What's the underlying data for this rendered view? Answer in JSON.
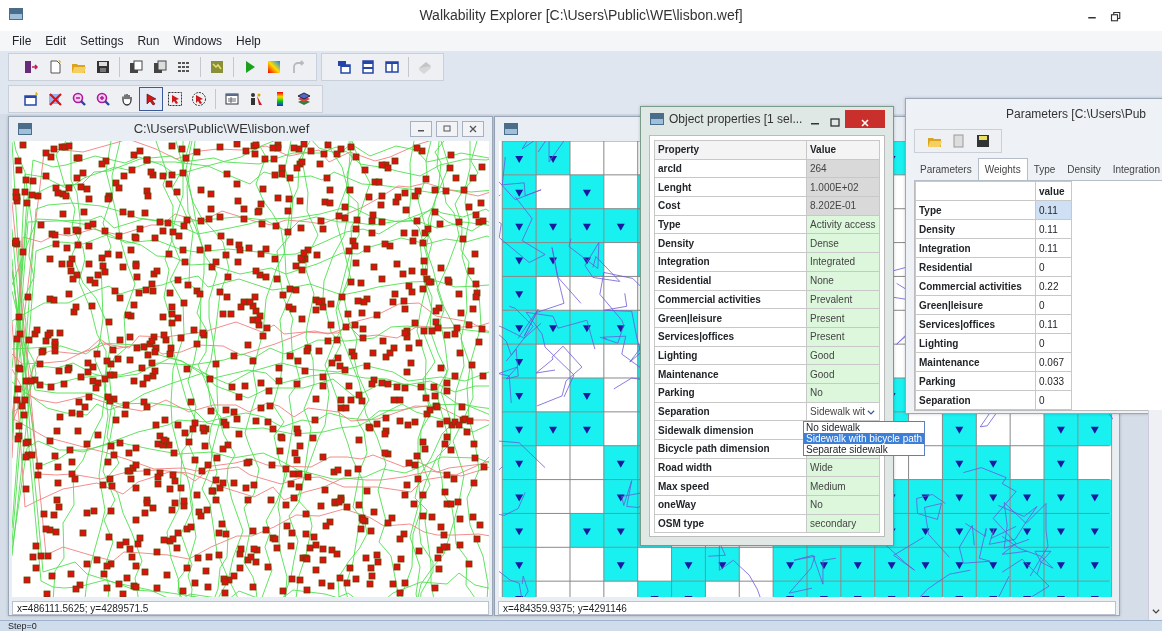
{
  "window": {
    "title": "Walkability Explorer [C:\\Users\\Public\\WE\\lisbon.wef]"
  },
  "menu": [
    "File",
    "Edit",
    "Settings",
    "Run",
    "Windows",
    "Help"
  ],
  "toolbar_1": [
    {
      "disabled": false
    },
    {
      "disabled": false
    },
    {
      "disabled": false
    },
    {
      "disabled": false
    },
    {
      "disabled": false
    },
    {
      "disabled": false
    },
    {
      "disabled": false
    },
    {
      "disabled": false
    },
    {
      "disabled": false
    },
    {
      "disabled": false
    },
    {
      "disabled": true
    },
    {
      "disabled": false
    },
    {
      "disabled": false
    },
    {
      "disabled": false
    },
    {
      "disabled": true
    }
  ],
  "toolbar_2": [
    {
      "selected": false
    },
    {
      "selected": false
    },
    {
      "selected": false
    },
    {
      "selected": false
    },
    {
      "selected": false
    },
    {
      "selected": true
    },
    {
      "selected": false
    },
    {
      "selected": false
    },
    {
      "selected": false
    },
    {
      "selected": false
    },
    {
      "selected": false
    },
    {
      "selected": false
    }
  ],
  "map_windows": [
    {
      "title": "C:\\Users\\Public\\WE\\lisbon.wef",
      "coordinates": "x=486111.5625; y=4289571.5"
    },
    {
      "coordinates": "x=484359.9375; y=4291146"
    }
  ],
  "object_properties": {
    "title": "Object properties [1 sel...",
    "columns": [
      "Property",
      "Value"
    ],
    "rows": [
      {
        "property": "arcId",
        "value": "264",
        "kind": "readonly"
      },
      {
        "property": "Lenght",
        "value": "1.000E+02",
        "kind": "readonly"
      },
      {
        "property": "Cost",
        "value": "8.202E-01",
        "kind": "readonly"
      },
      {
        "property": "Type",
        "value": "Activity access",
        "kind": "edit"
      },
      {
        "property": "Density",
        "value": "Dense",
        "kind": "edit"
      },
      {
        "property": "Integration",
        "value": "Integrated",
        "kind": "edit"
      },
      {
        "property": "Residential",
        "value": "None",
        "kind": "edit"
      },
      {
        "property": "Commercial activities",
        "value": "Prevalent",
        "kind": "edit"
      },
      {
        "property": "Green|leisure",
        "value": "Present",
        "kind": "edit"
      },
      {
        "property": "Services|offices",
        "value": "Present",
        "kind": "edit"
      },
      {
        "property": "Lighting",
        "value": "Good",
        "kind": "edit"
      },
      {
        "property": "Maintenance",
        "value": "Good",
        "kind": "edit"
      },
      {
        "property": "Parking",
        "value": "No",
        "kind": "edit"
      },
      {
        "property": "Separation",
        "value": "Sidewalk wit",
        "kind": "combo"
      },
      {
        "property": "Sidewalk dimension",
        "value": "",
        "kind": "edit"
      },
      {
        "property": "Bicycle path dimension",
        "value": "",
        "kind": "edit"
      },
      {
        "property": "Road width",
        "value": "Wide",
        "kind": "edit"
      },
      {
        "property": "Max speed",
        "value": "Medium",
        "kind": "edit"
      },
      {
        "property": "oneWay",
        "value": "No",
        "kind": "edit"
      },
      {
        "property": "OSM type",
        "value": "secondary",
        "kind": "edit"
      }
    ],
    "dropdown": [
      {
        "label": "No sidewalk",
        "selected": false
      },
      {
        "label": "Sidewalk with bicycle path",
        "selected": true
      },
      {
        "label": "Separate sidewalk",
        "selected": false
      }
    ]
  },
  "parameters": {
    "title": "Parameters [C:\\Users\\Pub",
    "tabs": [
      {
        "label": "Parameters",
        "selected": false
      },
      {
        "label": "Weights",
        "selected": true
      },
      {
        "label": "Type",
        "selected": false
      },
      {
        "label": "Density",
        "selected": false
      },
      {
        "label": "Integration",
        "selected": false
      }
    ],
    "column": "value",
    "rows": [
      {
        "name": "Type",
        "value": "0.11",
        "selected": true
      },
      {
        "name": "Density",
        "value": "0.11",
        "selected": false
      },
      {
        "name": "Integration",
        "value": "0.11",
        "selected": false
      },
      {
        "name": "Residential",
        "value": "0",
        "selected": false
      },
      {
        "name": "Commercial activities",
        "value": "0.22",
        "selected": false
      },
      {
        "name": "Green|leisure",
        "value": "0",
        "selected": false
      },
      {
        "name": "Services|offices",
        "value": "0.11",
        "selected": false
      },
      {
        "name": "Lighting",
        "value": "0",
        "selected": false
      },
      {
        "name": "Maintenance",
        "value": "0.067",
        "selected": false
      },
      {
        "name": "Parking",
        "value": "0.033",
        "selected": false
      },
      {
        "name": "Separation",
        "value": "0",
        "selected": false
      }
    ]
  },
  "status_bar": "Step=0"
}
